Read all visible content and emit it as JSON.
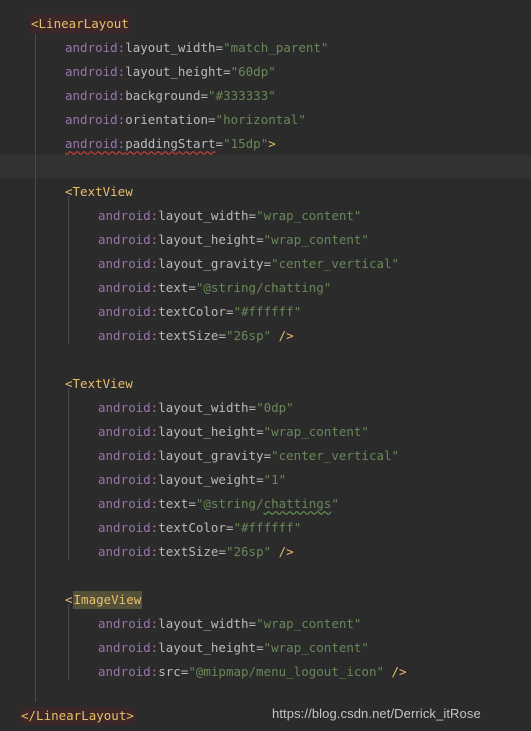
{
  "editor": {
    "background_color": "#2b2b2b",
    "current_line_color": "#323232",
    "indent_guide_color": "#4a4a4a",
    "tag_color": "#e8bf6a",
    "namespace_color": "#9876aa",
    "attribute_color": "#bababa",
    "value_color": "#6a8759",
    "match_highlight_color": "#3b2727",
    "selection_highlight_color": "#54503a",
    "error_squiggle_color": "#bc3f3c",
    "warning_squiggle_color": "#5d8a4e",
    "language": "xml"
  },
  "code": {
    "l1_tag": "<LinearLayout",
    "l2_ns": "android:",
    "l2_attr": "layout_width",
    "l2_eq": "=",
    "l2_val": "\"match_parent\"",
    "l3_ns": "android:",
    "l3_attr": "layout_height",
    "l3_eq": "=",
    "l3_val": "\"60dp\"",
    "l4_ns": "android:",
    "l4_attr": "background",
    "l4_eq": "=",
    "l4_val": "\"#333333\"",
    "l5_ns": "android:",
    "l5_attr": "orientation",
    "l5_eq": "=",
    "l5_val": "\"horizontal\"",
    "l6_ns": "android:",
    "l6_attr": "paddingStart",
    "l6_eq": "=",
    "l6_val": "\"15dp\"",
    "l6_close": ">",
    "l8_tag": "<TextView",
    "l9_ns": "android:",
    "l9_attr": "layout_width",
    "l9_eq": "=",
    "l9_val": "\"wrap_content\"",
    "l10_ns": "android:",
    "l10_attr": "layout_height",
    "l10_eq": "=",
    "l10_val": "\"wrap_content\"",
    "l11_ns": "android:",
    "l11_attr": "layout_gravity",
    "l11_eq": "=",
    "l11_val": "\"center_vertical\"",
    "l12_ns": "android:",
    "l12_attr": "text",
    "l12_eq": "=",
    "l12_val": "\"@string/chatting\"",
    "l13_ns": "android:",
    "l13_attr": "textColor",
    "l13_eq": "=",
    "l13_val": "\"#ffffff\"",
    "l14_ns": "android:",
    "l14_attr": "textSize",
    "l14_eq": "=",
    "l14_val": "\"26sp\"",
    "l14_close": "/>",
    "l16_tag": "<TextView",
    "l17_ns": "android:",
    "l17_attr": "layout_width",
    "l17_eq": "=",
    "l17_val": "\"0dp\"",
    "l18_ns": "android:",
    "l18_attr": "layout_height",
    "l18_eq": "=",
    "l18_val": "\"wrap_content\"",
    "l19_ns": "android:",
    "l19_attr": "layout_gravity",
    "l19_eq": "=",
    "l19_val": "\"center_vertical\"",
    "l20_ns": "android:",
    "l20_attr": "layout_weight",
    "l20_eq": "=",
    "l20_val": "\"1\"",
    "l21_ns": "android:",
    "l21_attr": "text",
    "l21_eq": "=",
    "l21_val_pre": "\"@string/",
    "l21_val_typo": "chattings",
    "l21_val_post": "\"",
    "l22_ns": "android:",
    "l22_attr": "textColor",
    "l22_eq": "=",
    "l22_val": "\"#ffffff\"",
    "l23_ns": "android:",
    "l23_attr": "textSize",
    "l23_eq": "=",
    "l23_val": "\"26sp\"",
    "l23_close": "/>",
    "l25_open": "<",
    "l25_tag": "ImageView",
    "l26_ns": "android:",
    "l26_attr": "layout_width",
    "l26_eq": "=",
    "l26_val": "\"wrap_content\"",
    "l27_ns": "android:",
    "l27_attr": "layout_height",
    "l27_eq": "=",
    "l27_val": "\"wrap_content\"",
    "l28_ns": "android:",
    "l28_attr": "src",
    "l28_eq": "=",
    "l28_val": "\"@mipmap/menu_logout_icon\"",
    "l28_close": "/>",
    "l30_tag": "</LinearLayout>"
  },
  "watermark": {
    "text": "https://blog.csdn.net/Derrick_itRose"
  }
}
